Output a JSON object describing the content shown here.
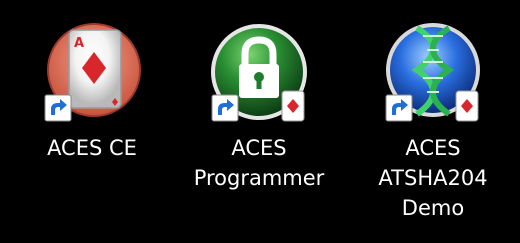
{
  "desktop": {
    "icons": [
      {
        "name": "aces-ce",
        "label_lines": [
          "ACES CE"
        ]
      },
      {
        "name": "aces-programmer",
        "label_lines": [
          "ACES",
          "Programmer"
        ]
      },
      {
        "name": "aces-atsha204-demo",
        "label_lines": [
          "ACES",
          "ATSHA204",
          "Demo"
        ]
      }
    ]
  },
  "colors": {
    "background": "#000000",
    "label": "#ffffff",
    "card_red": "#d8262a",
    "lock_green": "#1e7d2c",
    "dna_blue": "#1d54c9",
    "shortcut_arrow": "#1f6fd6"
  },
  "icon_names": {
    "aces_ce": "playing-card-icon",
    "programmer": "padlock-icon",
    "demo": "dna-helix-icon",
    "shortcut_overlay": "shortcut-arrow-icon",
    "card_overlay": "playing-card-badge-icon"
  }
}
